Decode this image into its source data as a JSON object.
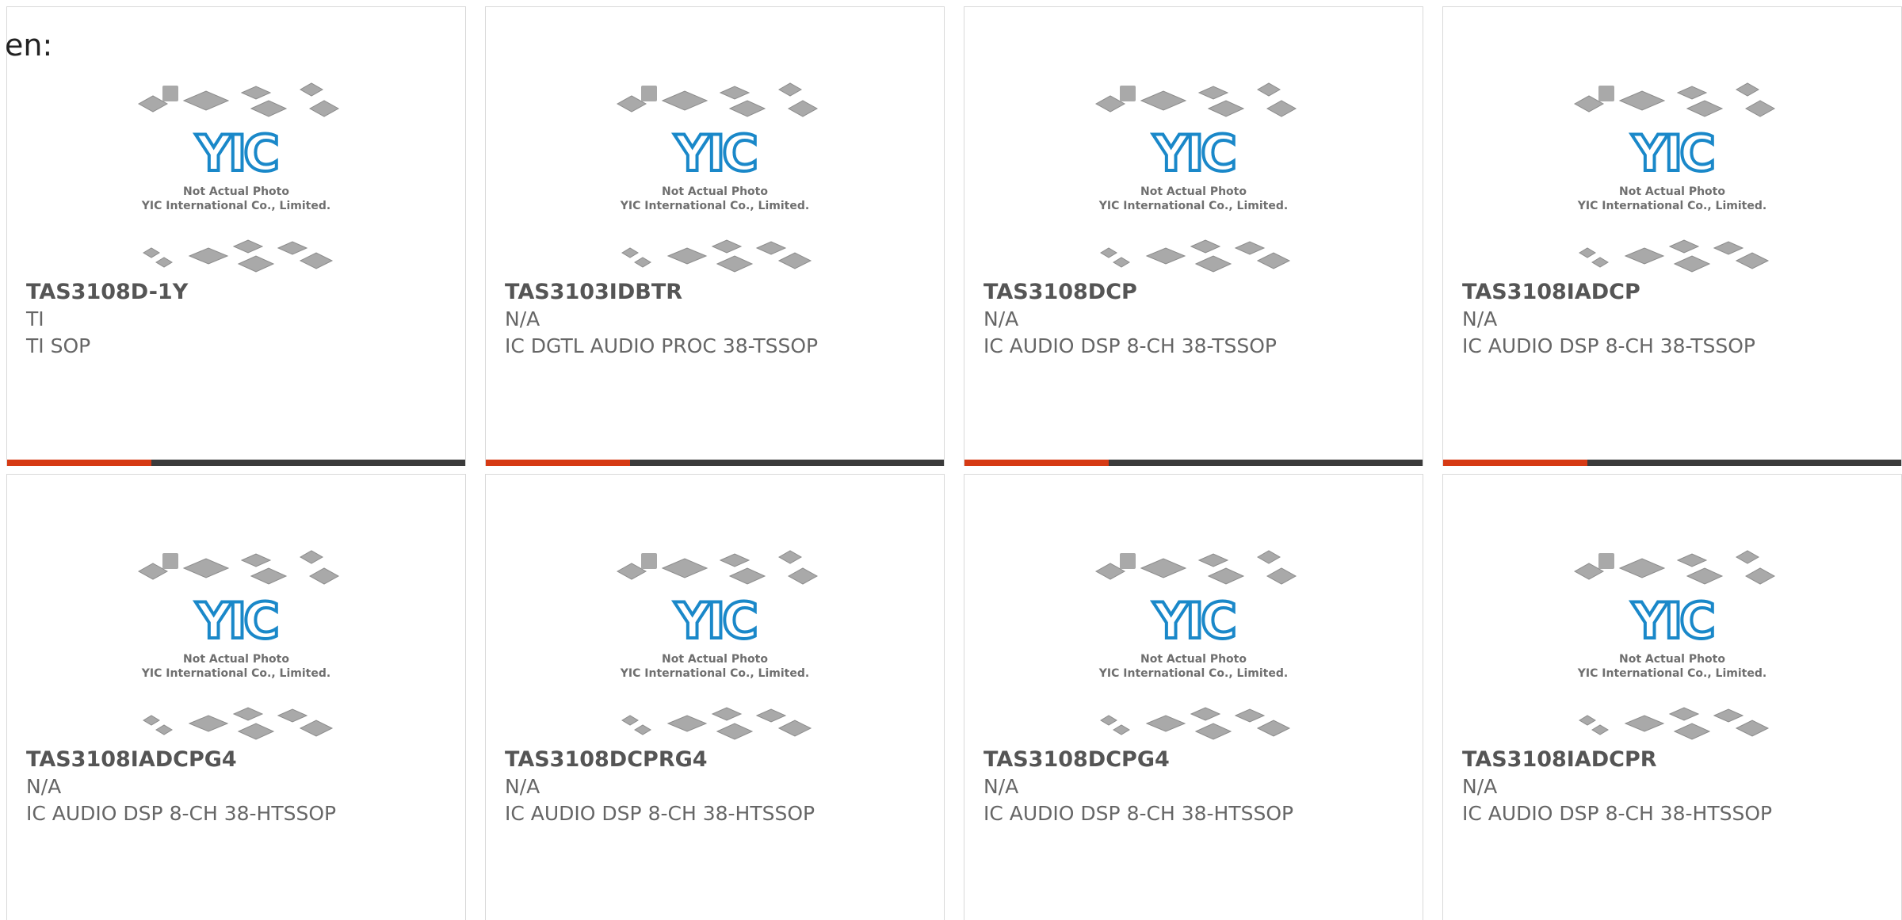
{
  "language_label": "en:",
  "photo": {
    "caption_line1": "Not Actual Photo",
    "caption_line2": "YIC International Co., Limited.",
    "logo_text": "YIC",
    "logo_color": "#1a88c9"
  },
  "colors": {
    "accent_bar": "#d63a14",
    "dark_bar": "#3b3b3b"
  },
  "products": [
    {
      "part_number": "TAS3108D-1Y",
      "manufacturer": "TI",
      "description": "TI SOP"
    },
    {
      "part_number": "TAS3103IDBTR",
      "manufacturer": "N/A",
      "description": "IC DGTL AUDIO PROC 38-TSSOP"
    },
    {
      "part_number": "TAS3108DCP",
      "manufacturer": "N/A",
      "description": "IC AUDIO DSP 8-CH 38-TSSOP"
    },
    {
      "part_number": "TAS3108IADCP",
      "manufacturer": "N/A",
      "description": "IC AUDIO DSP 8-CH 38-TSSOP"
    },
    {
      "part_number": "TAS3108IADCPG4",
      "manufacturer": "N/A",
      "description": "IC AUDIO DSP 8-CH 38-HTSSOP"
    },
    {
      "part_number": "TAS3108DCPRG4",
      "manufacturer": "N/A",
      "description": "IC AUDIO DSP 8-CH 38-HTSSOP"
    },
    {
      "part_number": "TAS3108DCPG4",
      "manufacturer": "N/A",
      "description": "IC AUDIO DSP 8-CH 38-HTSSOP"
    },
    {
      "part_number": "TAS3108IADCPR",
      "manufacturer": "N/A",
      "description": "IC AUDIO DSP 8-CH 38-HTSSOP"
    }
  ]
}
